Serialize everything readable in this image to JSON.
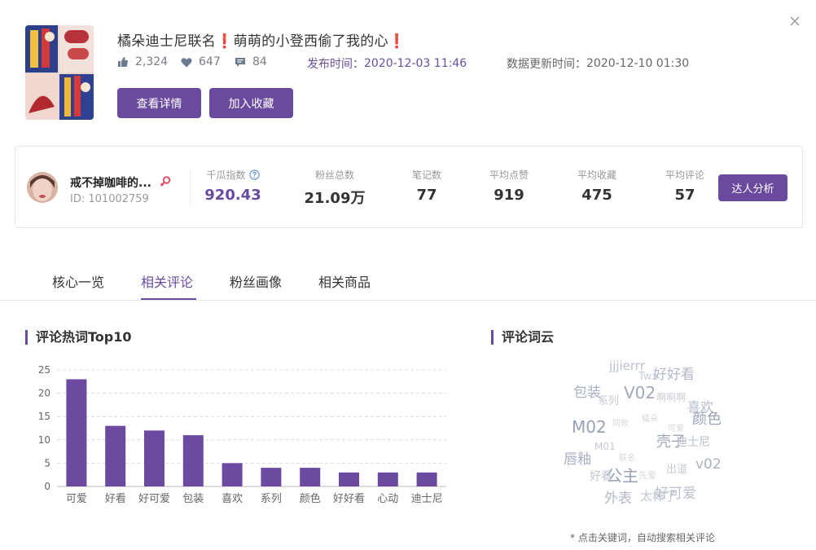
{
  "post": {
    "title_parts": [
      "橘朵迪士尼联名",
      "❗",
      "萌萌的小登西偷了我的心",
      "❗"
    ],
    "likes": "2,324",
    "collects": "647",
    "comments": "84",
    "publish_label": "发布时间：",
    "publish_time": "2020-12-03 11:46",
    "update_label": "数据更新时间：",
    "update_time": "2020-12-10 01:30",
    "btn_detail": "查看详情",
    "btn_fav": "加入收藏"
  },
  "influencer": {
    "name": "戒不掉咖啡的...",
    "id_label": "ID:",
    "id": "101002759",
    "stats": [
      {
        "label": "千瓜指数",
        "value": "920.43"
      },
      {
        "label": "粉丝总数",
        "value": "21.09万"
      },
      {
        "label": "笔记数",
        "value": "77"
      },
      {
        "label": "平均点赞",
        "value": "919"
      },
      {
        "label": "平均收藏",
        "value": "475"
      },
      {
        "label": "平均评论",
        "value": "57"
      }
    ],
    "btn_analysis": "达人分析"
  },
  "tabs": [
    "核心一览",
    "相关评论",
    "粉丝画像",
    "相关商品"
  ],
  "active_tab": "相关评论",
  "colors": {
    "accent": "#6a4a9f",
    "bar": "#6b4aa0",
    "female": "#e0455a"
  },
  "sections": {
    "hot_words_title": "评论热词Top10",
    "cloud_title": "评论词云",
    "cloud_hint": "* 点击关键词，自动搜索相关评论"
  },
  "chart_data": {
    "type": "bar",
    "categories": [
      "可爱",
      "好看",
      "好可爱",
      "包装",
      "喜欢",
      "系列",
      "颜色",
      "好好看",
      "心动",
      "迪士尼"
    ],
    "values": [
      23,
      13,
      12,
      11,
      5,
      4,
      4,
      3,
      3,
      3
    ],
    "yticks": [
      0,
      5,
      10,
      15,
      20,
      25
    ],
    "ylim": [
      0,
      25
    ],
    "grid": true
  },
  "word_cloud": [
    {
      "text": "jjjierrr",
      "color": "#b9c0d0",
      "size": 15
    },
    {
      "text": "好好看",
      "color": "#b2b9c9",
      "size": 17
    },
    {
      "text": "Twx",
      "color": "#c8cdd8",
      "size": 13
    },
    {
      "text": "包装",
      "color": "#a9b1c2",
      "size": 17
    },
    {
      "text": "V02",
      "color": "#a0a9bb",
      "size": 20
    },
    {
      "text": "系列",
      "color": "#c4c9d4",
      "size": 13
    },
    {
      "text": "啊啊啊",
      "color": "#c8ccd6",
      "size": 12
    },
    {
      "text": "喜欢",
      "color": "#b6bccb",
      "size": 16
    },
    {
      "text": "颜色",
      "color": "#9aa3b6",
      "size": 18
    },
    {
      "text": "M02",
      "color": "#98a2b5",
      "size": 20
    },
    {
      "text": "同款",
      "color": "#d3d7df",
      "size": 10
    },
    {
      "text": "橘朵",
      "color": "#d3d7df",
      "size": 10
    },
    {
      "text": "可爱",
      "color": "#d3d7df",
      "size": 10
    },
    {
      "text": "壳子",
      "color": "#9ea7b9",
      "size": 18
    },
    {
      "text": "迪士尼",
      "color": "#b8bfcd",
      "size": 14
    },
    {
      "text": "M01",
      "color": "#c6cbd5",
      "size": 12
    },
    {
      "text": "唇釉",
      "color": "#a8b0c1",
      "size": 17
    },
    {
      "text": "联名",
      "color": "#d3d7df",
      "size": 10
    },
    {
      "text": "出道",
      "color": "#c6cbd5",
      "size": 13
    },
    {
      "text": "v02",
      "color": "#a9b1c2",
      "size": 17
    },
    {
      "text": "公主",
      "color": "#98a2b5",
      "size": 20
    },
    {
      "text": "好看",
      "color": "#c0c6d2",
      "size": 14
    },
    {
      "text": "先爱",
      "color": "#d3d7df",
      "size": 11
    },
    {
      "text": "外表",
      "color": "#b2b9c9",
      "size": 17
    },
    {
      "text": "太棒了",
      "color": "#c0c6d2",
      "size": 15
    },
    {
      "text": "好可爱",
      "color": "#b9c0ce",
      "size": 17
    }
  ]
}
